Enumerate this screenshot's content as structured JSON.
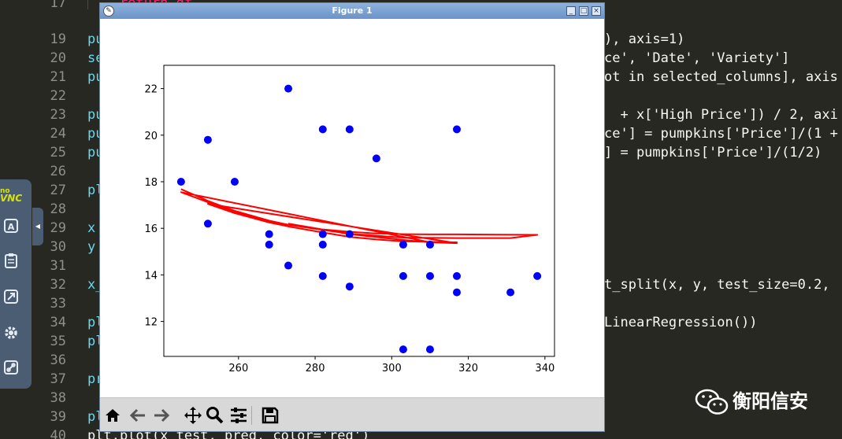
{
  "editor": {
    "gutter": [
      "17",
      "19",
      "20",
      "21",
      "22",
      "23",
      "24",
      "25",
      "26",
      "27",
      "28",
      "29",
      "30",
      "31",
      "32",
      "33",
      "34",
      "35",
      "36",
      "37",
      "38",
      "39",
      "40"
    ],
    "left_fragments": [
      {
        "text": "    return df",
        "color": "#f92672"
      },
      {
        "text": "pu",
        "color": "#66d9ef"
      },
      {
        "text": "se",
        "color": "#66d9ef"
      },
      {
        "text": "pu",
        "color": "#66d9ef"
      },
      {
        "text": "",
        "color": "#f8f8f2"
      },
      {
        "text": "pu",
        "color": "#66d9ef"
      },
      {
        "text": "pu",
        "color": "#66d9ef"
      },
      {
        "text": "pu",
        "color": "#66d9ef"
      },
      {
        "text": "",
        "color": "#f8f8f2"
      },
      {
        "text": "pl",
        "color": "#66d9ef"
      },
      {
        "text": "",
        "color": "#f8f8f2"
      },
      {
        "text": "x",
        "color": "#66d9ef"
      },
      {
        "text": "y",
        "color": "#66d9ef"
      },
      {
        "text": "",
        "color": "#f8f8f2"
      },
      {
        "text": "x_",
        "color": "#66d9ef"
      },
      {
        "text": "",
        "color": "#f8f8f2"
      },
      {
        "text": "pl",
        "color": "#66d9ef"
      },
      {
        "text": "pl",
        "color": "#66d9ef"
      },
      {
        "text": "",
        "color": "#f8f8f2"
      },
      {
        "text": "pr",
        "color": "#66d9ef"
      },
      {
        "text": "",
        "color": "#f8f8f2"
      },
      {
        "text": "pl",
        "color": "#66d9ef"
      },
      {
        "text": "plt.plot(x_test, pred, color='red')",
        "color": "#f8f8f2"
      }
    ],
    "right_fragments": [
      {
        "line": 1,
        "text": "), axis=1)"
      },
      {
        "line": 2,
        "text": "ce', 'Date', 'Variety']"
      },
      {
        "line": 3,
        "text": "ot in selected_columns], axis"
      },
      {
        "line": 5,
        "text": "  + x['High Price']) / 2, axi"
      },
      {
        "line": 6,
        "text": "ce'] = pumpkins['Price']/(1 +"
      },
      {
        "line": 7,
        "text": "] = pumpkins['Price']/(1/2)"
      },
      {
        "line": 14,
        "text": "t_split(x, y, test_size=0.2,"
      },
      {
        "line": 16,
        "text": "LinearRegression())"
      }
    ]
  },
  "vnc": {
    "logo": "noVNC",
    "buttons": [
      "A",
      "clipboard",
      "fullscreen",
      "settings",
      "disconnect"
    ]
  },
  "figure": {
    "title": "Figure 1",
    "window_buttons": [
      "_",
      "□",
      "×"
    ],
    "toolbar": [
      "home-icon",
      "back-icon",
      "forward-icon",
      "pan-icon",
      "zoom-icon",
      "configure-icon",
      "save-icon"
    ]
  },
  "chart_data": {
    "type": "scatter",
    "title": "",
    "xlabel": "",
    "ylabel": "",
    "xlim": [
      240.5,
      342.5
    ],
    "ylim": [
      10.5,
      23.0
    ],
    "xticks": [
      260,
      280,
      300,
      320,
      340
    ],
    "yticks": [
      12,
      14,
      16,
      18,
      20,
      22
    ],
    "grid": false,
    "series": [
      {
        "type": "scatter",
        "color": "#0000ff",
        "x": [
          245,
          252,
          252,
          259,
          268,
          268,
          273,
          273,
          282,
          282,
          282,
          282,
          289,
          289,
          289,
          296,
          303,
          303,
          303,
          310,
          310,
          310,
          317,
          317,
          317,
          331,
          338
        ],
        "y": [
          18.0,
          19.8,
          16.2,
          18.0,
          15.75,
          15.3,
          22.0,
          14.4,
          20.25,
          15.75,
          15.3,
          13.95,
          20.25,
          15.75,
          13.5,
          19.0,
          15.3,
          13.95,
          10.8,
          15.3,
          13.95,
          10.8,
          20.25,
          13.95,
          13.25,
          13.25,
          13.95
        ]
      },
      {
        "type": "line",
        "color": "#ff0000",
        "x": [
          245,
          252,
          259,
          268,
          273,
          282,
          289,
          296,
          303,
          310,
          317,
          338,
          331,
          317,
          303,
          296,
          289,
          282,
          273,
          268,
          259,
          252,
          245,
          310,
          317,
          303,
          296,
          289,
          282,
          273,
          268,
          259,
          252,
          317,
          310,
          303,
          289,
          282,
          273
        ],
        "y": [
          17.68,
          17.18,
          16.75,
          16.33,
          16.15,
          15.95,
          15.85,
          15.78,
          15.75,
          15.74,
          15.74,
          15.72,
          15.58,
          15.58,
          15.6,
          15.68,
          15.77,
          15.93,
          16.15,
          16.3,
          16.7,
          17.12,
          17.55,
          15.4,
          15.4,
          15.44,
          15.52,
          15.63,
          15.82,
          16.08,
          16.25,
          16.65,
          17.05,
          15.36,
          15.4,
          15.5,
          15.75,
          15.95,
          16.2
        ]
      }
    ]
  },
  "watermark": {
    "text": "衡阳信安",
    "icon": "wechat-icon"
  }
}
